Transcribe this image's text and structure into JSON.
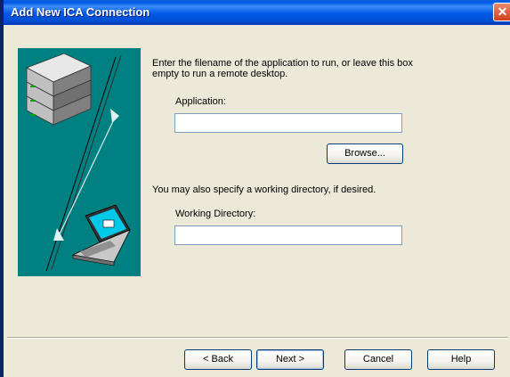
{
  "dialog": {
    "title": "Add New ICA Connection"
  },
  "instructions": "Enter the filename of the application to run, or leave this box empty to run a remote desktop.",
  "application": {
    "label": "Application:",
    "value": ""
  },
  "browse_label": "Browse...",
  "workdir_hint": "You may also specify a working directory, if desired.",
  "workdir": {
    "label": "Working Directory:",
    "value": ""
  },
  "buttons": {
    "back": "< Back",
    "next": "Next >",
    "cancel": "Cancel",
    "help": "Help"
  },
  "icons": {
    "close": "close-icon",
    "server": "server-icon",
    "laptop": "laptop-icon"
  },
  "colors": {
    "titlebar": "#0058e6",
    "graphic_bg": "#008080",
    "dialog_bg": "#ece9d8",
    "close": "#d2401c"
  }
}
